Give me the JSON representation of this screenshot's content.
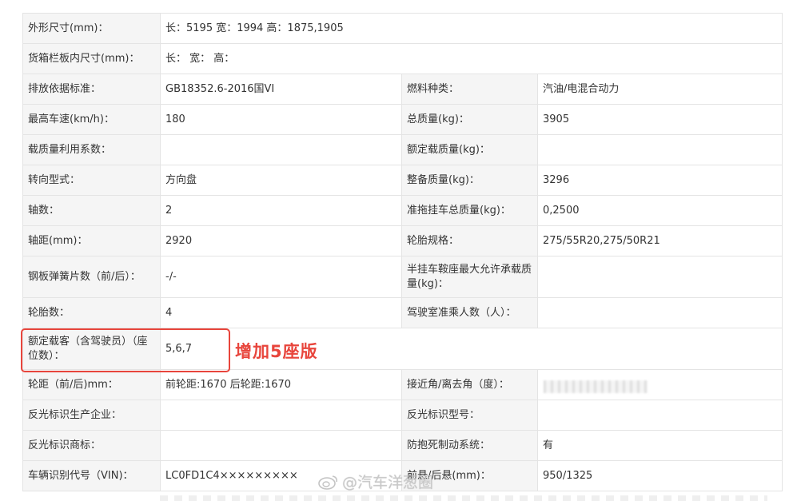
{
  "rows": [
    {
      "k1": "外形尺寸(mm)：",
      "v1": "长：5195 宽：1994 高：1875,1905"
    },
    {
      "k1": "货箱栏板内尺寸(mm)：",
      "v1": "长：  宽：  高："
    },
    {
      "k1": "排放依据标准：",
      "v1": "GB18352.6-2016国VI",
      "k2": "燃料种类：",
      "v2": "汽油/电混合动力"
    },
    {
      "k1": "最高车速(km/h)：",
      "v1": "180",
      "k2": "总质量(kg)：",
      "v2": "3905"
    },
    {
      "k1": "载质量利用系数：",
      "v1": "",
      "k2": "额定载质量(kg)：",
      "v2": ""
    },
    {
      "k1": "转向型式：",
      "v1": "方向盘",
      "k2": "整备质量(kg)：",
      "v2": "3296"
    },
    {
      "k1": "轴数：",
      "v1": "2",
      "k2": "准拖挂车总质量(kg)：",
      "v2": "0,2500"
    },
    {
      "k1": "轴距(mm)：",
      "v1": "2920",
      "k2": "轮胎规格：",
      "v2": "275/55R20,275/50R21"
    },
    {
      "k1": "钢板弹簧片数（前/后）：",
      "v1": "-/-",
      "k2": "半挂车鞍座最大允许承载质量(kg)：",
      "v2": ""
    },
    {
      "k1": "轮胎数：",
      "v1": "4",
      "k2": "驾驶室准乘人数（人）：",
      "v2": ""
    },
    {
      "k1": "额定载客（含驾驶员）（座位数）：",
      "v1": "5,6,7"
    },
    {
      "k1": "轮距（前/后)mm：",
      "v1": "前轮距:1670 后轮距:1670",
      "k2": "接近角/离去角（度）：",
      "v2": ""
    },
    {
      "k1": "反光标识生产企业：",
      "v1": "",
      "k2": "反光标识型号：",
      "v2": ""
    },
    {
      "k1": "反光标识商标：",
      "v1": "",
      "k2": "防抱死制动系统：",
      "v2": "有"
    },
    {
      "k1": "车辆识别代号（VIN)：",
      "v1": "LC0FD1C4×××××××××",
      "k2": "前悬/后悬(mm)：",
      "v2": "950/1325"
    }
  ],
  "annotation": "增加5座版",
  "watermark": "@汽车洋葱圈",
  "colors": {
    "accent": "#e8453c",
    "label_bg": "#f5f5f5",
    "border": "#e4e4e4"
  }
}
